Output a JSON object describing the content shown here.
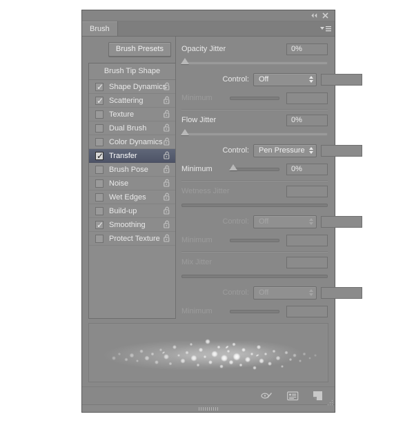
{
  "window": {
    "collapse_icon": "double-chevron-left-icon",
    "close_icon": "close-icon"
  },
  "tabs": [
    {
      "label": "Brush",
      "active": true
    }
  ],
  "panel_menu": {
    "icon": "panel-menu-icon"
  },
  "left": {
    "presets_button": "Brush Presets",
    "list_header": "Brush Tip Shape",
    "items": [
      {
        "label": "Shape Dynamics",
        "checked": true,
        "selected": false,
        "lock": "unlocked-padlock-icon"
      },
      {
        "label": "Scattering",
        "checked": true,
        "selected": false,
        "lock": "unlocked-padlock-icon"
      },
      {
        "label": "Texture",
        "checked": false,
        "selected": false,
        "lock": "unlocked-padlock-icon"
      },
      {
        "label": "Dual Brush",
        "checked": false,
        "selected": false,
        "lock": "unlocked-padlock-icon"
      },
      {
        "label": "Color Dynamics",
        "checked": false,
        "selected": false,
        "lock": "unlocked-padlock-icon"
      },
      {
        "label": "Transfer",
        "checked": true,
        "selected": true,
        "lock": "unlocked-padlock-icon"
      },
      {
        "label": "Brush Pose",
        "checked": false,
        "selected": false,
        "lock": "unlocked-padlock-icon"
      },
      {
        "label": "Noise",
        "checked": false,
        "selected": false,
        "lock": "unlocked-padlock-icon"
      },
      {
        "label": "Wet Edges",
        "checked": false,
        "selected": false,
        "lock": "unlocked-padlock-icon"
      },
      {
        "label": "Build-up",
        "checked": false,
        "selected": false,
        "lock": "unlocked-padlock-icon"
      },
      {
        "label": "Smoothing",
        "checked": true,
        "selected": false,
        "lock": "unlocked-padlock-icon"
      },
      {
        "label": "Protect Texture",
        "checked": false,
        "selected": false,
        "lock": "unlocked-padlock-icon"
      }
    ]
  },
  "right": {
    "sections": [
      {
        "title": "Opacity Jitter",
        "value": "0%",
        "slider_percent": 0,
        "enabled": true,
        "control_label": "Control:",
        "control_value": "Off",
        "control_value_box": "",
        "minimum_label": "Minimum",
        "minimum_value": "",
        "minimum_percent": 0,
        "minimum_enabled": false
      },
      {
        "title": "Flow Jitter",
        "value": "0%",
        "slider_percent": 0,
        "enabled": true,
        "control_label": "Control:",
        "control_value": "Pen Pressure",
        "control_value_box": "",
        "minimum_label": "Minimum",
        "minimum_value": "0%",
        "minimum_percent": 0,
        "minimum_enabled": true
      },
      {
        "title": "Wetness Jitter",
        "value": "",
        "slider_percent": 0,
        "enabled": false,
        "control_label": "Control:",
        "control_value": "Off",
        "control_value_box": "",
        "minimum_label": "Minimum",
        "minimum_value": "",
        "minimum_percent": 0,
        "minimum_enabled": false
      },
      {
        "title": "Mix Jitter",
        "value": "",
        "slider_percent": 0,
        "enabled": false,
        "control_label": "Control:",
        "control_value": "Off",
        "control_value_box": "",
        "minimum_label": "Minimum",
        "minimum_value": "",
        "minimum_percent": 0,
        "minimum_enabled": false
      }
    ]
  },
  "preview": {
    "name": "brush-stroke-preview"
  },
  "footer": {
    "icons": [
      {
        "name": "toggle-airbrush-icon"
      },
      {
        "name": "brush-panel-options-icon"
      },
      {
        "name": "new-brush-preset-icon"
      }
    ],
    "resize_grip": "resize-grip-icon"
  },
  "bottom_grip": {
    "name": "panel-drag-grip"
  }
}
